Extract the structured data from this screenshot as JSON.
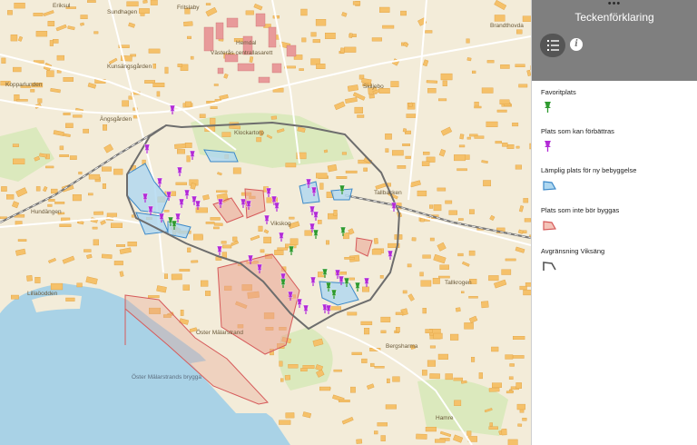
{
  "map": {
    "colors": {
      "background": "#f3ecd9",
      "water": "#a9d2e6",
      "building": "#f5c16a",
      "park": "#d9e8b8",
      "road": "#ffffff",
      "boundary": "#6d6d6d"
    },
    "labels": [
      {
        "text": "Hemdal",
        "id": "hemdal"
      },
      {
        "text": "Västerås centrallasarett",
        "id": "hospital"
      },
      {
        "text": "Klockartorp",
        "id": "klockartorp"
      },
      {
        "text": "Skiljebo",
        "id": "skiljebo"
      },
      {
        "text": "Kopparlunden",
        "id": "kopparlunden"
      },
      {
        "text": "Kunsängsgården",
        "id": "kunsangsgarden"
      },
      {
        "text": "Vikskog",
        "id": "viksang"
      },
      {
        "text": "Hundängen",
        "id": "hundangen"
      },
      {
        "text": "Lillaöodden",
        "id": "lillaodden"
      },
      {
        "text": "Öster Mälarstrand",
        "id": "oster-malarstrand"
      },
      {
        "text": "Öster Mälarstrands brygga",
        "id": "brygga"
      },
      {
        "text": "Tallbacken",
        "id": "tallbacken"
      },
      {
        "text": "Tallkrogen",
        "id": "tallkrogen"
      },
      {
        "text": "Bergsharma",
        "id": "bergsharma"
      },
      {
        "text": "Hamre",
        "id": "hamre"
      },
      {
        "text": "Brandthovda",
        "id": "brandthovda"
      },
      {
        "text": "Sundhagen",
        "id": "sundhagen"
      },
      {
        "text": "Eriksul",
        "id": "eriksul"
      },
      {
        "text": "Fritslaby",
        "id": "fritslaby"
      },
      {
        "text": "Ängsgården",
        "id": "angsgarden"
      }
    ]
  },
  "panel": {
    "dots": "•••",
    "title": "Teckenförklaring",
    "legend_button_icon": "list-icon",
    "info_button_icon": "info-icon",
    "info_glyph": "i",
    "legend": [
      {
        "title": "Favoritplats",
        "symbol": "pin",
        "color": "#2e9a2e"
      },
      {
        "title": "Plats som kan förbättras",
        "symbol": "pin",
        "color": "#b22ad6"
      },
      {
        "title": "Lämplig plats för ny bebyggelse",
        "symbol": "polygon",
        "fill": "#aed7f0",
        "stroke": "#3d89c8"
      },
      {
        "title": "Plats som inte bör byggas",
        "symbol": "polygon",
        "fill": "#f4c3b8",
        "stroke": "#d65a5a"
      },
      {
        "title": "Avgränsning Viksäng",
        "symbol": "polyline",
        "stroke": "#555555"
      }
    ]
  }
}
